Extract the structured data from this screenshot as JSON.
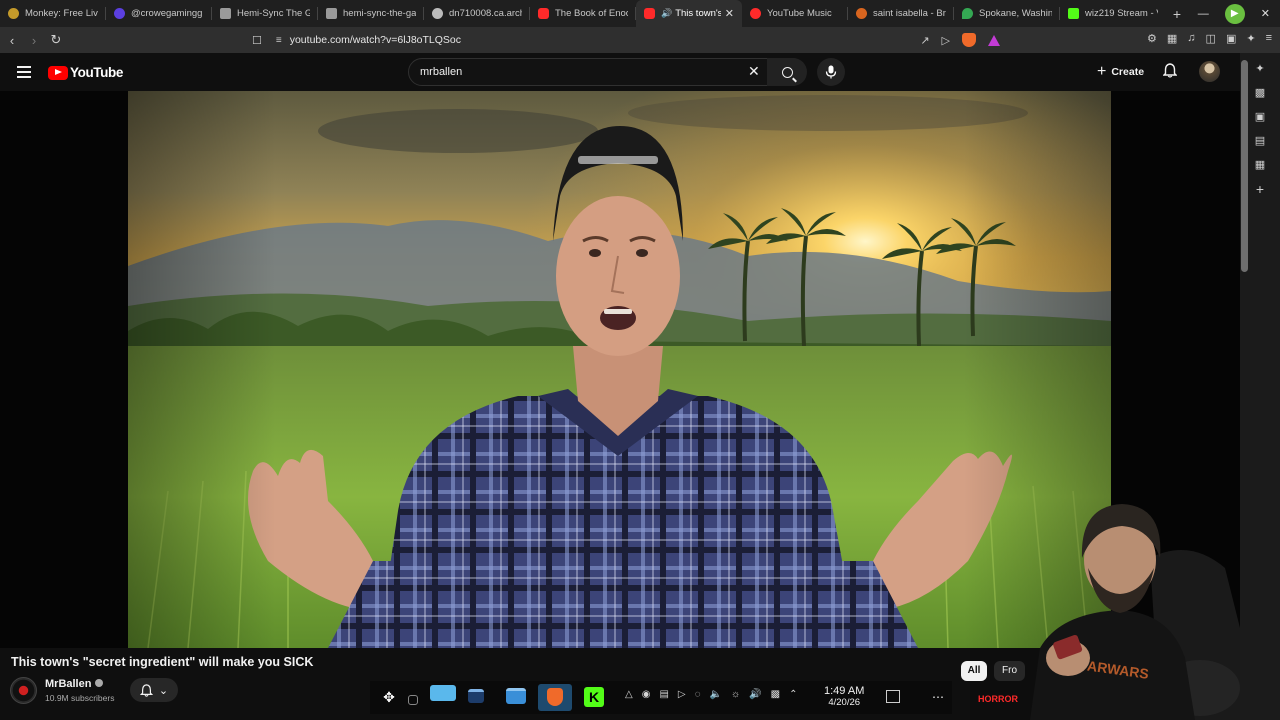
{
  "browser": {
    "tabs": [
      {
        "label": "Monkey: Free Live",
        "color": "#c49a2a",
        "active": false
      },
      {
        "label": "@crowegamingg",
        "color": "#5b3fe0",
        "active": false
      },
      {
        "label": "Hemi-Sync The G",
        "color": "#9a9a9a",
        "active": false
      },
      {
        "label": "hemi-sync-the-ga",
        "color": "#9a9a9a",
        "active": false
      },
      {
        "label": "dn710008.ca.arch",
        "color": "#bbbbbb",
        "active": false
      },
      {
        "label": "The Book of Enoc",
        "color": "#ff2a2a",
        "active": false
      },
      {
        "label": "This town's",
        "color": "#ff2a2a",
        "active": true
      },
      {
        "label": "YouTube Music",
        "color": "#ff2a2a",
        "active": false
      },
      {
        "label": "saint isabella - Br",
        "color": "#d8651f",
        "active": false
      },
      {
        "label": "Spokane, Washin",
        "color": "#34a853",
        "active": false
      },
      {
        "label": "wiz219 Stream - V",
        "color": "#53fc18",
        "active": false
      }
    ],
    "url": "youtube.com/watch?v=6lJ8oTLQSoc"
  },
  "youtube": {
    "logo_text": "YouTube",
    "search_value": "mrballen",
    "create_label": "Create"
  },
  "video": {
    "title": "This town's \"secret ingredient\" will make you SICK",
    "channel": "MrBallen",
    "subscribers": "10.9M subscribers"
  },
  "chips": {
    "all": "All",
    "from": "Fro"
  },
  "taskbar": {
    "time": "1:49 AM",
    "date": "4/20/26"
  },
  "icons": {
    "back": "arrow-left-icon",
    "forward": "arrow-right-icon",
    "reload": "reload-icon",
    "search": "search-icon",
    "mic": "microphone-icon",
    "bell": "bell-icon",
    "clear": "close-icon"
  }
}
